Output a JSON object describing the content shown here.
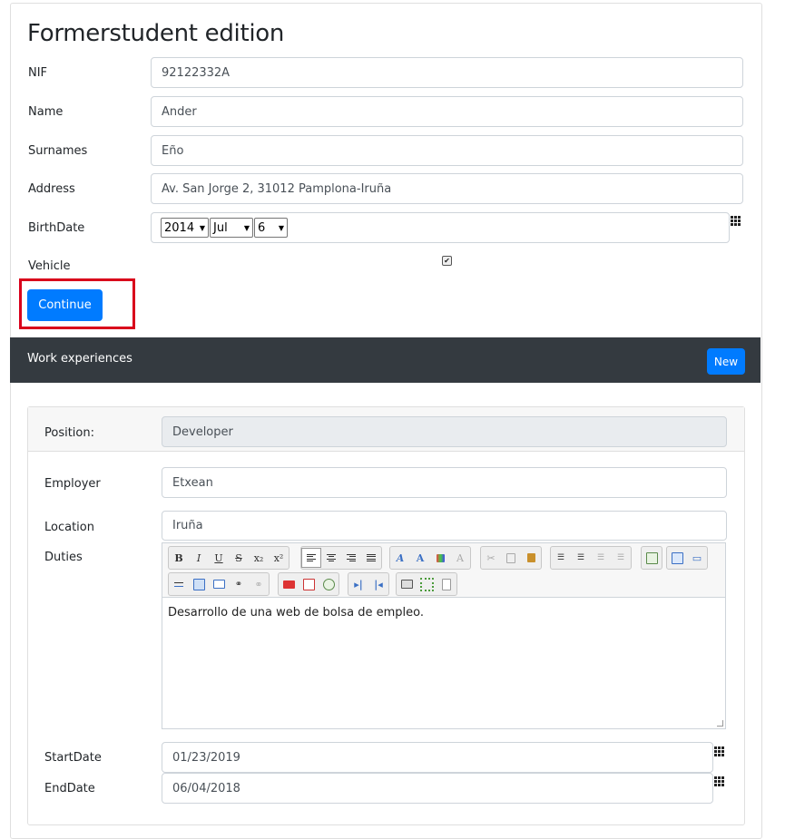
{
  "form": {
    "title": "Formerstudent edition",
    "nif": {
      "label": "NIF",
      "value": "92122332A"
    },
    "name": {
      "label": "Name",
      "value": "Ander"
    },
    "surnames": {
      "label": "Surnames",
      "value": "Eño"
    },
    "address": {
      "label": "Address",
      "value": "Av. San Jorge 2, 31012 Pamplona-Iruña"
    },
    "birthdate": {
      "label": "BirthDate",
      "year": "2014",
      "month": "Jul",
      "day": "6"
    },
    "vehicle": {
      "label": "Vehicle",
      "checked": true,
      "check_glyph": "✔"
    },
    "continue_label": "Continue"
  },
  "work": {
    "header_title": "Work experiences",
    "new_label": "New",
    "position": {
      "label": "Position:",
      "value": "Developer"
    },
    "employer": {
      "label": "Employer",
      "value": "Etxean"
    },
    "location": {
      "label": "Location",
      "value": "Iruña"
    },
    "duties": {
      "label": "Duties",
      "value": "Desarrollo de una web de bolsa de empleo."
    },
    "startdate": {
      "label": "StartDate",
      "value": "01/23/2019"
    },
    "enddate": {
      "label": "EndDate",
      "value": "06/04/2018"
    }
  },
  "toolbar": {
    "bold": "B",
    "italic": "I",
    "underline": "U",
    "strike": "S",
    "subscript": "x₂",
    "superscript": "x²"
  },
  "colors": {
    "primary": "#007bff",
    "dark_header": "#343a40",
    "highlight": "#d9001b"
  },
  "icons": [
    "calendar-grid-icon",
    "checkbox-check-icon",
    "resize-handle-icon"
  ]
}
